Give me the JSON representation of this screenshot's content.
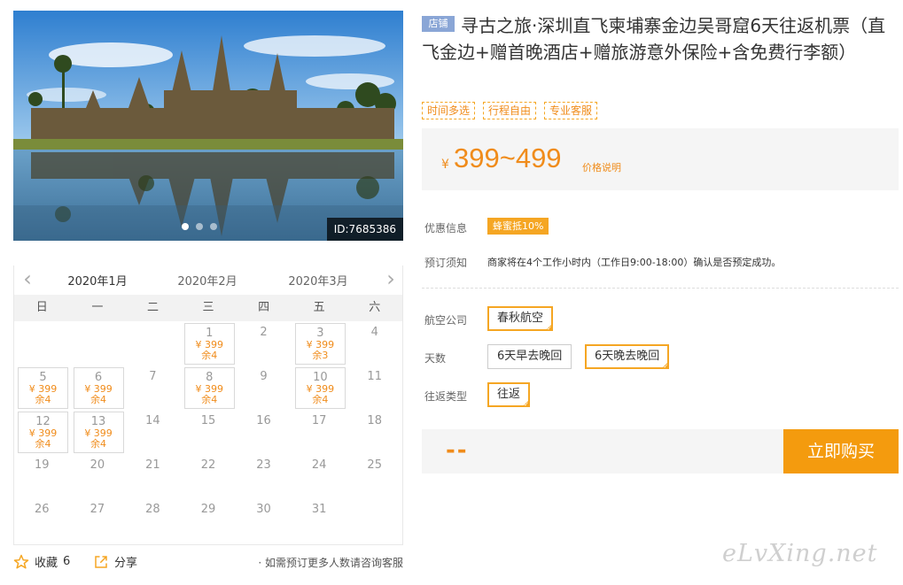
{
  "hero": {
    "image_subject": "temple reflected in lake",
    "id_label": "ID:7685386",
    "dots": 3,
    "active_dot": 1
  },
  "product": {
    "shop_tag": "店铺",
    "title": "寻古之旅·深圳直飞柬埔寨金边吴哥窟6天往返机票（直飞金边+赠首晚酒店+赠旅游意外保险+含免费行李额）",
    "feature_tags": [
      "时间多选",
      "行程自由",
      "专业客服"
    ],
    "price_symbol": "¥",
    "price": "399~499",
    "price_note": "价格说明"
  },
  "info": {
    "promo_label": "优惠信息",
    "promo_badge": "蜂蜜抵10%",
    "notice_label": "预订须知",
    "notice_text": "商家将在4个工作小时内（工作日9:00-18:00）确认是否预定成功。"
  },
  "options": {
    "airline_label": "航空公司",
    "airline": "春秋航空",
    "days_label": "天数",
    "days_options": [
      "6天早去晚回",
      "6天晚去晚回"
    ],
    "days_selected": 1,
    "trip_label": "往返类型",
    "trip": "往返"
  },
  "buy": {
    "total": "--",
    "button": "立即购买"
  },
  "calendar": {
    "months": [
      "2020年1月",
      "2020年2月",
      "2020年3月"
    ],
    "active_month": 0,
    "weekdays": [
      "日",
      "一",
      "二",
      "三",
      "四",
      "五",
      "六"
    ],
    "days": [
      {
        "d": "1",
        "col": 3,
        "row": 0,
        "price": "¥ 399",
        "stock": "余4"
      },
      {
        "d": "2",
        "col": 4,
        "row": 0
      },
      {
        "d": "3",
        "col": 5,
        "row": 0,
        "price": "¥ 399",
        "stock": "余3"
      },
      {
        "d": "4",
        "col": 6,
        "row": 0
      },
      {
        "d": "5",
        "col": 0,
        "row": 1,
        "price": "¥ 399",
        "stock": "余4"
      },
      {
        "d": "6",
        "col": 1,
        "row": 1,
        "price": "¥ 399",
        "stock": "余4"
      },
      {
        "d": "7",
        "col": 2,
        "row": 1
      },
      {
        "d": "8",
        "col": 3,
        "row": 1,
        "price": "¥ 399",
        "stock": "余4"
      },
      {
        "d": "9",
        "col": 4,
        "row": 1
      },
      {
        "d": "10",
        "col": 5,
        "row": 1,
        "price": "¥ 399",
        "stock": "余4"
      },
      {
        "d": "11",
        "col": 6,
        "row": 1
      },
      {
        "d": "12",
        "col": 0,
        "row": 2,
        "price": "¥ 399",
        "stock": "余4"
      },
      {
        "d": "13",
        "col": 1,
        "row": 2,
        "price": "¥ 399",
        "stock": "余4"
      },
      {
        "d": "14",
        "col": 2,
        "row": 2
      },
      {
        "d": "15",
        "col": 3,
        "row": 2
      },
      {
        "d": "16",
        "col": 4,
        "row": 2
      },
      {
        "d": "17",
        "col": 5,
        "row": 2
      },
      {
        "d": "18",
        "col": 6,
        "row": 2
      },
      {
        "d": "19",
        "col": 0,
        "row": 3
      },
      {
        "d": "20",
        "col": 1,
        "row": 3
      },
      {
        "d": "21",
        "col": 2,
        "row": 3
      },
      {
        "d": "22",
        "col": 3,
        "row": 3
      },
      {
        "d": "23",
        "col": 4,
        "row": 3
      },
      {
        "d": "24",
        "col": 5,
        "row": 3
      },
      {
        "d": "25",
        "col": 6,
        "row": 3
      },
      {
        "d": "26",
        "col": 0,
        "row": 4
      },
      {
        "d": "27",
        "col": 1,
        "row": 4
      },
      {
        "d": "28",
        "col": 2,
        "row": 4
      },
      {
        "d": "29",
        "col": 3,
        "row": 4
      },
      {
        "d": "30",
        "col": 4,
        "row": 4
      },
      {
        "d": "31",
        "col": 5,
        "row": 4
      }
    ]
  },
  "footer": {
    "favorite_label": "收藏",
    "favorite_count": "6",
    "share_label": "分享",
    "consult": "· 如需预订更多人数请咨询客服"
  },
  "watermark": "eLvXing.net",
  "colors": {
    "accent": "#f49b0e",
    "price": "#f08c1b",
    "shop_tag": "#8aa6d6"
  }
}
